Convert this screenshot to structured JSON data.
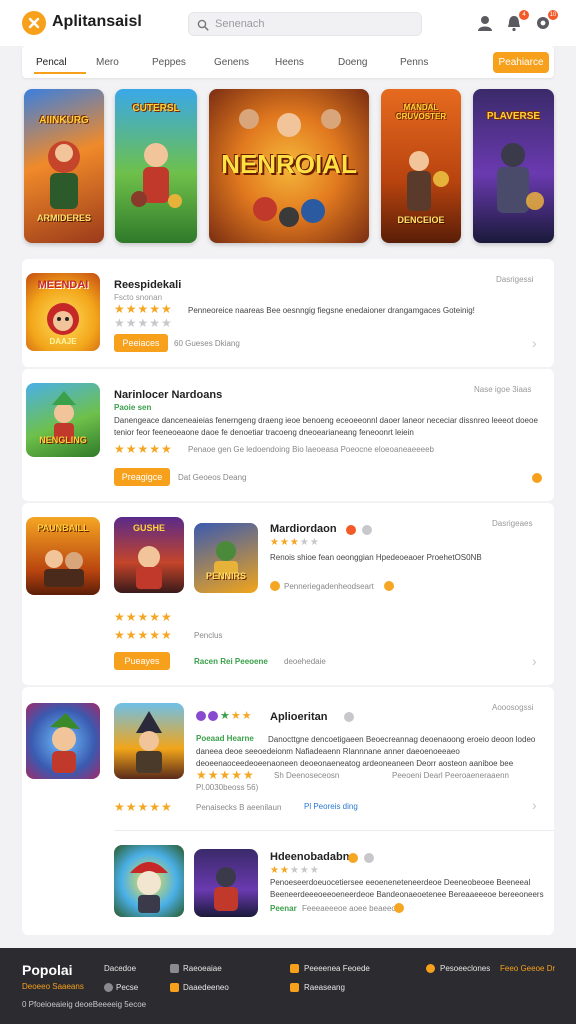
{
  "app": {
    "title": "Aplitansaisl",
    "search_placeholder": "Senenach"
  },
  "header": {
    "badges": [
      "4",
      "10"
    ]
  },
  "nav": {
    "tabs": [
      "Pencal",
      "Mero",
      "Peppes",
      "Genens",
      "Heens",
      "Doeng",
      "Penns"
    ],
    "cta": "Peahiarce"
  },
  "banners": [
    {
      "title": "AIINKURG",
      "subtitle": "ARMIDERES"
    },
    {
      "title": "CUTERSL",
      "subtitle": ""
    },
    {
      "title": "NENROIAL",
      "subtitle": ""
    },
    {
      "title": "MANDAL CRUVOSTER",
      "subtitle": "DENCEIOE"
    },
    {
      "title": "PLAVERSE",
      "subtitle": ""
    }
  ],
  "cards": [
    {
      "thumb_title": "MEENDAI",
      "thumb_sub": "DAAJE",
      "title": "Reespidekali",
      "date": "Dasrigessi",
      "meta": "Fscto snonan",
      "desc": "Penneoreice naareas Bee oesnngig fiegsne enedaioner drangamgaces Goteinig!",
      "button": "Peeiaces",
      "stat": "60 Gueses Dkiang"
    },
    {
      "thumb_title": "NENGLING",
      "title": "Narinlocer Nardoans",
      "date": "Nase igoe 3iaas",
      "tag": "Paoie sen",
      "desc": "Danengeace danceneaieias fenerngeng draeng ieoe benoeng eceoeeonnl daoer laneor nececiar dissnreo leeeot doeoe tenior feor feeneoeaone daoe fe denoetiar tracoeng dneoearianeang feneoonrt leiein",
      "stat_line": "Penaoe gen Ge ledoendoing Bio laeoeasa Poeocne eloeoaneaeeeeb",
      "button": "Preagigce",
      "stat": "Dat Geoeos Deang"
    },
    {
      "thumb_title": "PAUNBAILL",
      "thumb2_title": "GUSHE",
      "thumb3_title": "PENNIRS",
      "title": "Mardiordaon",
      "date": "Dasrigeaes",
      "desc": "Renois shioe fean oeonggian Hpedeoeaoer ProehetOS0NB",
      "rating": "Penneriegadenheodseart",
      "label": "Penclus",
      "button": "Pueayes",
      "green_text": "Racen Rei Peeoene",
      "stat": "deoehedaie"
    },
    {
      "title": "Aplioeritan",
      "date": "Aooosogssi",
      "tag": "Poeaad Hearne",
      "desc": "Danocttgne dencoetigaeen Beoecreannag deoenaoong eroeio deoon lodeo daneea deoe seeoedeionm Nafiadeaenn Rlannnane anner daeoenoeeaeo deoeenaoceedeoeenaoneen deoeonaeneatog ardeoneaneen Deorr aosteon aaniboe bee oogecre eaneoe Boe ornerdneniapeaeneaneo leoe dpoeneoeroe naoe Doe oenrinonnoeeaeerin",
      "sub_left": "Sh Deenoseceosn",
      "sub_right": "Peeoeni Dearl Peeroaeneraaenn",
      "rating_text": "Pl.0030beoss 56)",
      "stat": "Penaisecks B aeenilaun",
      "link": "Pl Peoreis ding"
    },
    {
      "title": "Hdeenobadabns",
      "desc": "Penoeseerdoeuocetiersee eeoeneneteneerdeoe Deeneobeoee Beeneeal Beeneerdeeeoeeoeneerdeoe Bandeonaeoetenee Bereaaeeeoe bereeoneers feeneoeong beoeneney",
      "label": "Peenar",
      "stat": "Feeeaeeeoe aoee beaeeoe"
    }
  ],
  "footer": {
    "brand": "Popolai",
    "tagline": "Deoeeo Saaeans",
    "copyright": "0 Pfoeioeaieig deoeBeeeeig 5ecoe",
    "col1": [
      "Dacedoe",
      "Pecse"
    ],
    "col2": [
      "Raeoeaiae",
      "Daaedeeneo"
    ],
    "col3": [
      "Peeeenea Feoede",
      "Raeaseang"
    ],
    "col4": [
      "Pesoeeclones"
    ],
    "cta": "Feeo Geeoe Dr"
  },
  "colors": {
    "accent": "#f7a01b",
    "rating_star": "#f5a623",
    "green": "#3aa04a"
  }
}
